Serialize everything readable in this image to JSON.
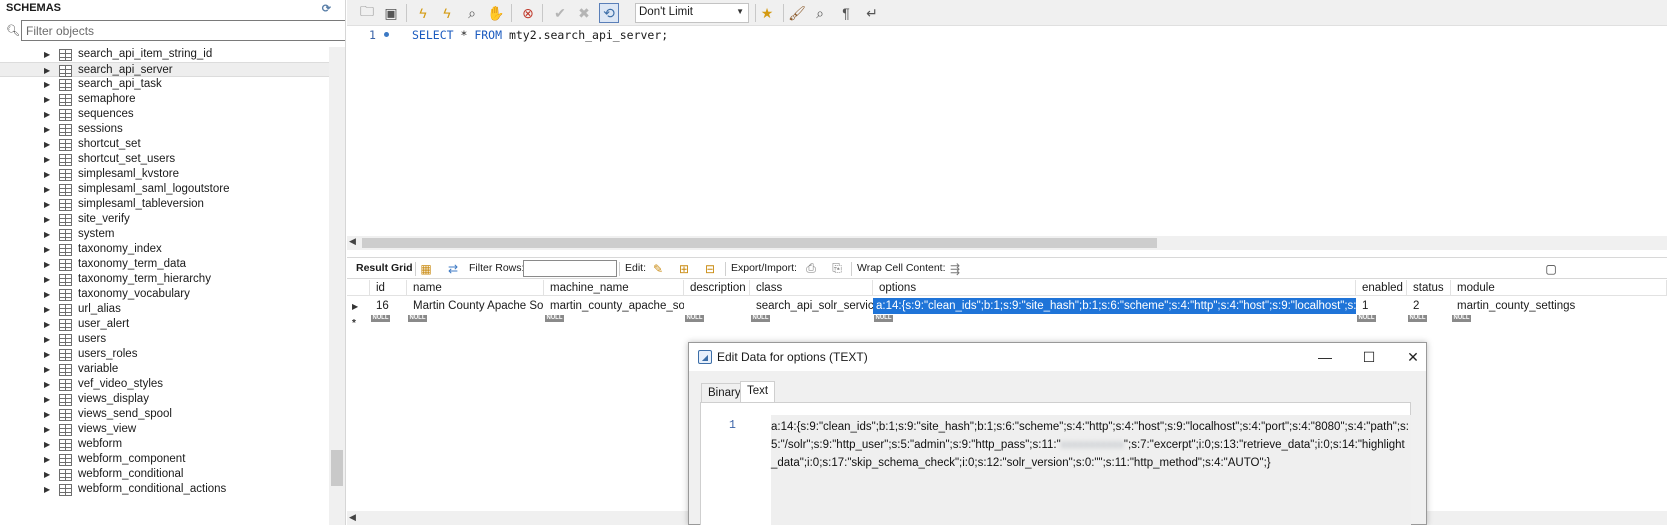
{
  "sidebar": {
    "title": "SCHEMAS",
    "filter_placeholder": "Filter objects",
    "tables": [
      "search_api_item_string_id",
      "search_api_server",
      "search_api_task",
      "semaphore",
      "sequences",
      "sessions",
      "shortcut_set",
      "shortcut_set_users",
      "simplesaml_kvstore",
      "simplesaml_saml_logoutstore",
      "simplesaml_tableversion",
      "site_verify",
      "system",
      "taxonomy_index",
      "taxonomy_term_data",
      "taxonomy_term_hierarchy",
      "taxonomy_vocabulary",
      "url_alias",
      "user_alert",
      "users",
      "users_roles",
      "variable",
      "vef_video_styles",
      "views_display",
      "views_send_spool",
      "views_view",
      "webform",
      "webform_component",
      "webform_conditional",
      "webform_conditional_actions"
    ],
    "selected_index": 1
  },
  "toolbar": {
    "limit_label": "Don't Limit"
  },
  "editor": {
    "line_number": "1",
    "kw_select": "SELECT",
    "star": " * ",
    "kw_from": "FROM",
    "table_ref": " mty2.search_api_server;"
  },
  "result_toolbar": {
    "result_grid": "Result Grid",
    "filter_rows": "Filter Rows:",
    "edit": "Edit:",
    "export_import": "Export/Import:",
    "wrap_cell": "Wrap Cell Content:"
  },
  "grid": {
    "columns": [
      "id",
      "name",
      "machine_name",
      "description",
      "class",
      "options",
      "enabled",
      "status",
      "module"
    ],
    "row": {
      "id": "16",
      "name": "Martin County Apache Solr",
      "machine_name": "martin_county_apache_solr",
      "description": "",
      "class": "search_api_solr_service",
      "options": "a:14:{s:9:\"clean_ids\";b:1;s:9:\"site_hash\";b:1;s:6:\"scheme\";s:4:\"http\";s:4:\"host\";s:9:\"localhost\";s:4:\"...",
      "enabled": "1",
      "status": "2",
      "module": "martin_county_settings"
    },
    "null_label": "NULL"
  },
  "dialog": {
    "title": "Edit Data for options (TEXT)",
    "tabs": [
      "Binary",
      "Text"
    ],
    "active_tab": "Text",
    "line_number": "1",
    "value_before": "a:14:{s:9:\"clean_ids\";b:1;s:9:\"site_hash\";b:1;s:6:\"scheme\";s:4:\"http\";s:4:\"host\";s:9:\"localhost\";s:4:\"port\";s:4:\"8080\";s:4:\"path\";s:5:\"/solr\";s:9:\"http_user\";s:5:\"admin\";s:9:\"http_pass\";s:11:\"",
    "value_redacted": "xxxxxxxxxxx",
    "value_after": "\";s:7:\"excerpt\";i:0;s:13:\"retrieve_data\";i:0;s:14:\"highlight_data\";i:0;s:17:\"skip_schema_check\";i:0;s:12:\"solr_version\";s:0:\"\";s:11:\"http_method\";s:4:\"AUTO\";}"
  },
  "colors": {
    "selection": "#1f74d8",
    "keyword": "#1b5bbf",
    "null_badge": "#8a8a8a"
  }
}
